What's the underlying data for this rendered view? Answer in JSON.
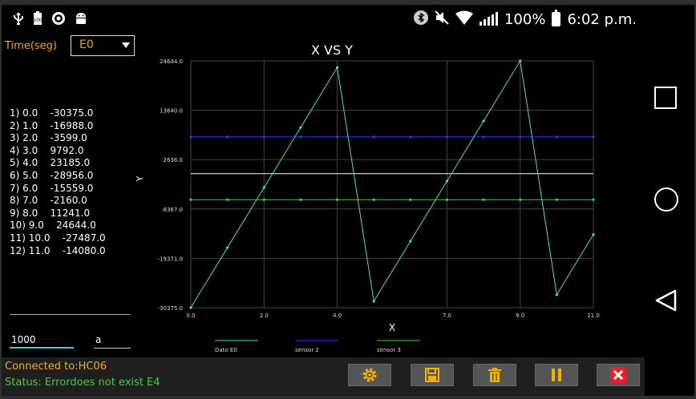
{
  "statusbar": {
    "left_icons": [
      "usb-icon",
      "battery-100-icon",
      "target-icon",
      "android-icon"
    ],
    "right_icons": [
      "bluetooth-icon",
      "mute-icon",
      "wifi-icon",
      "signal-icon",
      "battery-icon"
    ],
    "battery_text": "100%",
    "time": "6:02 p.m."
  },
  "left_panel": {
    "time_label": "Time(seg)",
    "dropdown_value": "E0",
    "readings": [
      "1) 0.0    -30375.0",
      "2) 1.0    -16988.0",
      "3) 2.0    -3599.0",
      "4) 3.0    9792.0",
      "5) 4.0    23185.0",
      "6) 5.0    -28956.0",
      "7) 6.0    -15559.0",
      "8) 7.0    -2160.0",
      "9) 8.0    11241.0",
      "10) 9.0    24644.0",
      "11) 10.0    -27487.0",
      "12) 11.0    -14080.0"
    ],
    "input_value": "1000",
    "input2_value": "a"
  },
  "chart_data": {
    "type": "line",
    "title": "X VS Y",
    "xlabel": "X",
    "ylabel": "Y",
    "xlim": [
      0.0,
      11.0
    ],
    "ylim": [
      -30375.0,
      24644.0
    ],
    "x_ticks": [
      "0.0",
      "2.0",
      "4.0",
      "7.0",
      "9.0",
      "11.0"
    ],
    "x_tick_values": [
      0,
      2,
      4,
      7,
      9,
      11
    ],
    "y_ticks": [
      "24644.0",
      "13640.0",
      "2636.0",
      "-8367.0",
      "-19371.0",
      "-30375.0"
    ],
    "y_tick_values": [
      24644.0,
      13640.0,
      2636.0,
      -8367.0,
      -19371.0,
      -30375.0
    ],
    "x": [
      0,
      1,
      2,
      3,
      4,
      5,
      6,
      7,
      8,
      9,
      10,
      11
    ],
    "series": [
      {
        "name": "Dato E0",
        "color": "#40e0d0",
        "values": [
          -30375.0,
          -16988.0,
          -3599.0,
          9792.0,
          23185.0,
          -28956.0,
          -15559.0,
          -2160.0,
          11241.0,
          24644.0,
          -27487.0,
          -14080.0
        ]
      },
      {
        "name": "sensor 2",
        "color": "#1f3fff",
        "values": [
          7700,
          7700,
          7700,
          7700,
          7700,
          7700,
          7700,
          7700,
          7700,
          7700,
          7700,
          7700
        ]
      },
      {
        "name": "sensor 3",
        "color": "#2ee02e",
        "values": [
          -6300,
          -6300,
          -6300,
          -6300,
          -6300,
          -6300,
          -6300,
          -6300,
          -6300,
          -6300,
          -6300,
          -6300
        ]
      }
    ],
    "reference_line": {
      "value": -500,
      "color": "#ffffff"
    },
    "grid": true,
    "legend_position": "bottom"
  },
  "bottom": {
    "connected_text": "Connected to:HC06",
    "status_text": "Status: Errordoes not exist E4",
    "buttons": [
      "settings-button",
      "save-button",
      "delete-button",
      "pause-button",
      "close-button"
    ]
  },
  "colors": {
    "accent_orange": "#f5a623",
    "status_green": "#3fcf3f",
    "button_icon_yellow": "#f2b100",
    "close_red": "#e8202a"
  }
}
